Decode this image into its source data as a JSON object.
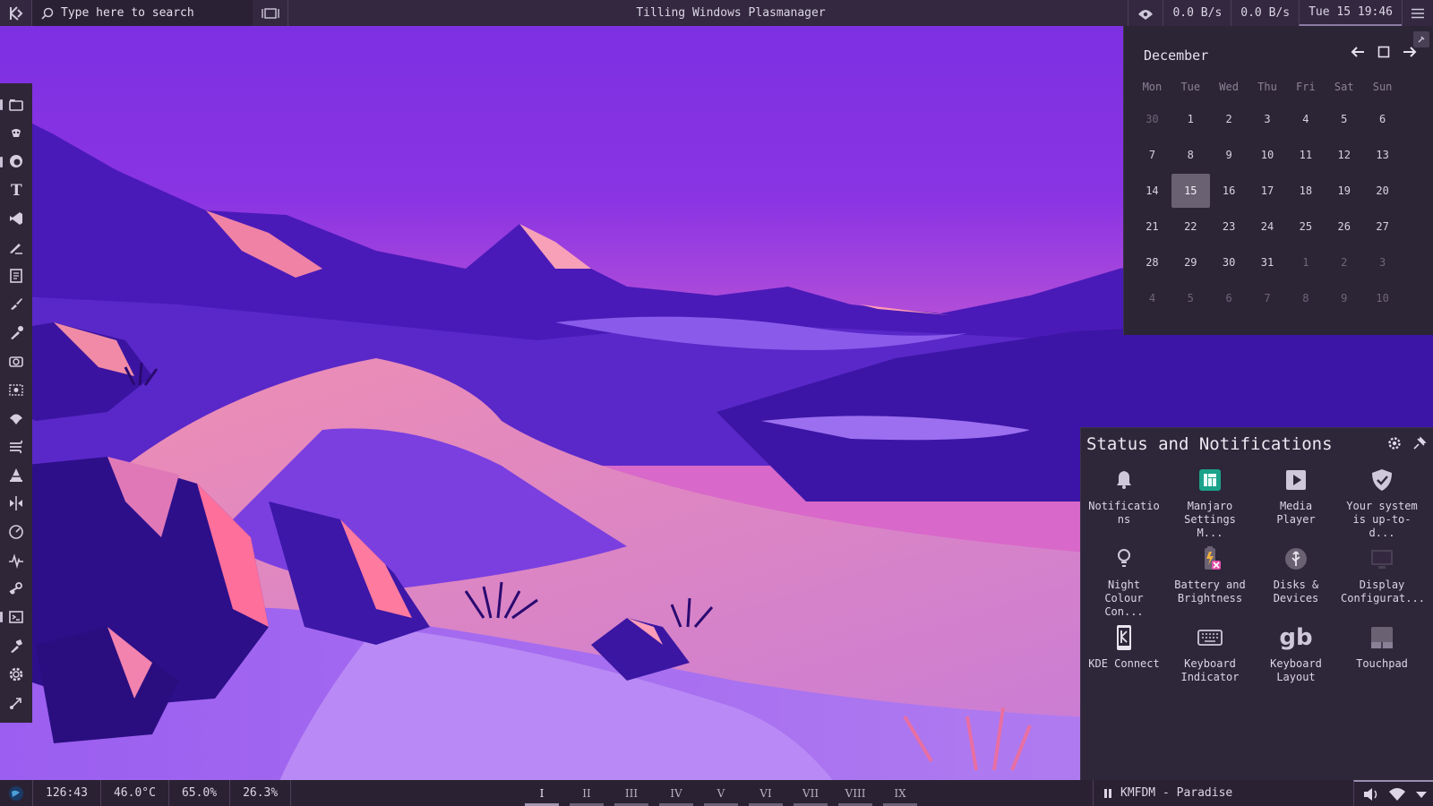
{
  "top_panel": {
    "search_placeholder": "Type here to search",
    "window_title": "Tilling Windows Plasmanager",
    "net_down": "0.0 B/s",
    "net_up": "0.0 B/s",
    "clock": "Tue 15 19:46",
    "icons": [
      "kde-logo-icon",
      "search-icon",
      "overview-icon",
      "network-icon",
      "hamburger-menu-icon"
    ]
  },
  "dock": {
    "items": [
      {
        "name": "file-manager-icon",
        "running": true
      },
      {
        "name": "gimp-icon",
        "running": false
      },
      {
        "name": "firefox-icon",
        "running": true
      },
      {
        "name": "text-editor-icon",
        "running": false
      },
      {
        "name": "vscode-icon",
        "running": false
      },
      {
        "name": "pen-icon",
        "running": false
      },
      {
        "name": "notes-icon",
        "running": false
      },
      {
        "name": "brush-icon",
        "running": false
      },
      {
        "name": "color-picker-icon",
        "running": false
      },
      {
        "name": "camera-icon",
        "running": false
      },
      {
        "name": "screenshot-icon",
        "running": false
      },
      {
        "name": "brain-icon",
        "running": false
      },
      {
        "name": "wind-icon",
        "running": false
      },
      {
        "name": "vlc-icon",
        "running": false
      },
      {
        "name": "split-icon",
        "running": false
      },
      {
        "name": "steam-speed-icon",
        "running": false
      },
      {
        "name": "activity-icon",
        "running": false
      },
      {
        "name": "steam-icon",
        "running": false
      },
      {
        "name": "terminal-icon",
        "running": true
      },
      {
        "name": "hammer-icon",
        "running": false
      },
      {
        "name": "settings-gear-icon",
        "running": false
      },
      {
        "name": "kdeconnect-share-icon",
        "running": false
      }
    ]
  },
  "calendar": {
    "month": "December",
    "weekdays": [
      "Mon",
      "Tue",
      "Wed",
      "Thu",
      "Fri",
      "Sat",
      "Sun"
    ],
    "weeks": [
      [
        {
          "d": "30",
          "dim": true
        },
        {
          "d": "1"
        },
        {
          "d": "2"
        },
        {
          "d": "3"
        },
        {
          "d": "4"
        },
        {
          "d": "5"
        },
        {
          "d": "6"
        }
      ],
      [
        {
          "d": "7"
        },
        {
          "d": "8"
        },
        {
          "d": "9"
        },
        {
          "d": "10"
        },
        {
          "d": "11"
        },
        {
          "d": "12"
        },
        {
          "d": "13"
        }
      ],
      [
        {
          "d": "14"
        },
        {
          "d": "15",
          "today": true
        },
        {
          "d": "16"
        },
        {
          "d": "17"
        },
        {
          "d": "18"
        },
        {
          "d": "19"
        },
        {
          "d": "20"
        }
      ],
      [
        {
          "d": "21"
        },
        {
          "d": "22"
        },
        {
          "d": "23"
        },
        {
          "d": "24"
        },
        {
          "d": "25"
        },
        {
          "d": "26"
        },
        {
          "d": "27"
        }
      ],
      [
        {
          "d": "28"
        },
        {
          "d": "29"
        },
        {
          "d": "30"
        },
        {
          "d": "31"
        },
        {
          "d": "1",
          "dim": true
        },
        {
          "d": "2",
          "dim": true
        },
        {
          "d": "3",
          "dim": true
        }
      ],
      [
        {
          "d": "4",
          "dim": true
        },
        {
          "d": "5",
          "dim": true
        },
        {
          "d": "6",
          "dim": true
        },
        {
          "d": "7",
          "dim": true
        },
        {
          "d": "8",
          "dim": true
        },
        {
          "d": "9",
          "dim": true
        },
        {
          "d": "10",
          "dim": true
        }
      ]
    ]
  },
  "tray": {
    "title": "Status and Notifications",
    "items": [
      {
        "label": "Notificatio\nns",
        "icon": "bell-icon"
      },
      {
        "label": "Manjaro\nSettings M...",
        "icon": "manjaro-icon"
      },
      {
        "label": "Media\nPlayer",
        "icon": "media-player-icon"
      },
      {
        "label": "Your system\nis up-to-d...",
        "icon": "shield-check-icon"
      },
      {
        "label": "Night\nColour Con...",
        "icon": "lightbulb-icon"
      },
      {
        "label": "Battery and\nBrightness",
        "icon": "battery-icon"
      },
      {
        "label": "Disks &\nDevices",
        "icon": "usb-icon"
      },
      {
        "label": "Display\nConfigurat...",
        "icon": "monitor-icon"
      },
      {
        "label": "KDE Connect",
        "icon": "kde-connect-icon"
      },
      {
        "label": "Keyboard\nIndicator",
        "icon": "keyboard-icon"
      },
      {
        "label": "Keyboard\nLayout",
        "icon": "keyboard-layout-icon",
        "glyph": "gb"
      },
      {
        "label": "Touchpad",
        "icon": "touchpad-icon"
      }
    ]
  },
  "bottom_panel": {
    "coords": "126:43",
    "temp": "46.0°C",
    "cpu": "65.0%",
    "mem": "26.3%",
    "desktops": [
      "I",
      "II",
      "III",
      "IV",
      "V",
      "VI",
      "VII",
      "VIII",
      "IX"
    ],
    "active_desktop_index": 0,
    "now_playing": "KMFDM - Paradise"
  },
  "colors": {
    "panel_bg": "#33283f",
    "popup_bg": "#2e2639",
    "sky_top": "#7a2fe0",
    "sky_bottom": "#c65bd9",
    "sand_pink": "#ee8fb8"
  }
}
